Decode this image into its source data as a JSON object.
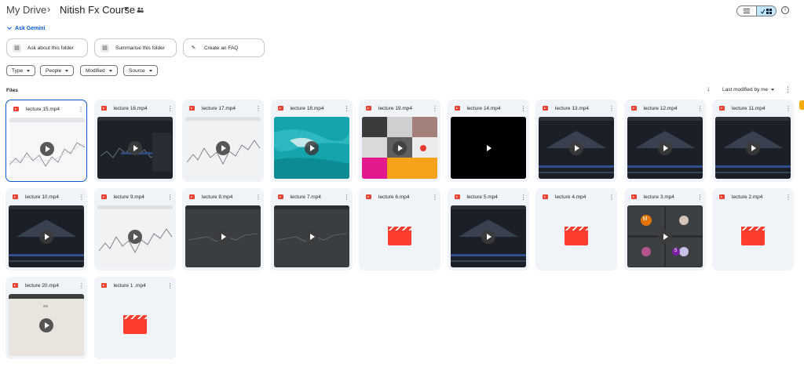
{
  "breadcrumb": {
    "root": "My Drive",
    "separator": "›",
    "current": "Nitish Fx Course"
  },
  "view_toggle": {
    "list_icon": "list-icon",
    "grid_icon": "grid-icon",
    "active": "grid"
  },
  "gemini": {
    "toggle_label": "Ask Gemini",
    "chips": [
      {
        "label": "Ask about this folder",
        "icon": "folder-query-icon"
      },
      {
        "label": "Summarise this folder",
        "icon": "summarise-icon"
      },
      {
        "label": "Create an FAQ",
        "icon": "sparkle-icon"
      }
    ]
  },
  "filters": [
    {
      "label": "Type"
    },
    {
      "label": "People"
    },
    {
      "label": "Modified"
    },
    {
      "label": "Source"
    }
  ],
  "files": {
    "section_label": "Files",
    "sort_label": "Last modified by me"
  },
  "items": [
    {
      "title": "lecture 15.mp4",
      "thumb": "white-chart",
      "selected": true
    },
    {
      "title": "lecture 16.mp4",
      "thumb": "dark-trade"
    },
    {
      "title": "lecture 17.mp4",
      "thumb": "light-chart"
    },
    {
      "title": "lecture 18.mp4",
      "thumb": "ocean"
    },
    {
      "title": "lecture 19.mp4",
      "thumb": "mosaic"
    },
    {
      "title": "lecture 14.mp4",
      "thumb": "black"
    },
    {
      "title": "lecture 13.mp4",
      "thumb": "black-screen"
    },
    {
      "title": "lecture 12.mp4",
      "thumb": "black-screen"
    },
    {
      "title": "lecture 11.mp4",
      "thumb": "black-screen"
    },
    {
      "title": "lecture 10.mp4",
      "thumb": "black-screen"
    },
    {
      "title": "lecture 9.mp4",
      "thumb": "light-chart"
    },
    {
      "title": "lecture 8.mp4",
      "thumb": "gray"
    },
    {
      "title": "lecture 7.mp4",
      "thumb": "gray"
    },
    {
      "title": "lecture 6.mp4",
      "thumb": "video-placeholder"
    },
    {
      "title": "lecture 5.mp4",
      "thumb": "black-screen"
    },
    {
      "title": "lecture 4.mp4",
      "thumb": "video-placeholder"
    },
    {
      "title": "lecture 3.mp4",
      "thumb": "meet"
    },
    {
      "title": "lecture 2.mp4",
      "thumb": "video-placeholder"
    },
    {
      "title": "lecture 20.mp4",
      "thumb": "beige"
    },
    {
      "title": "lecture 1 .mp4",
      "thumb": "video-placeholder"
    }
  ],
  "meet_avatars": [
    "M",
    "S"
  ],
  "colors": {
    "accent": "#0b57d0",
    "selected_toggle": "#c2e7ff",
    "card_bg": "#f0f4f9",
    "video_red": "#ea4335"
  }
}
